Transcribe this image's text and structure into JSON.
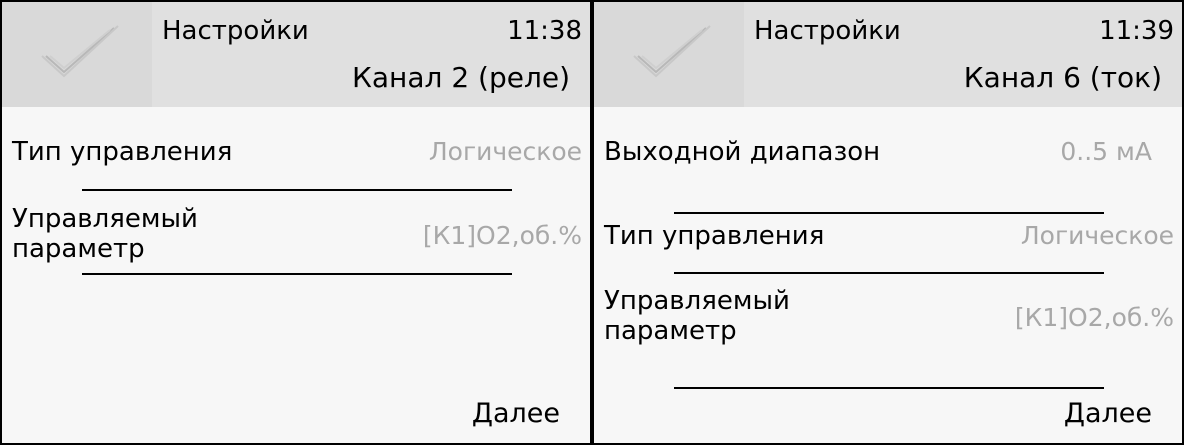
{
  "screens": [
    {
      "header": {
        "title": "Настройки",
        "time": "11:38",
        "channel": "Канал 2 (реле)"
      },
      "rows": [
        {
          "label": "Тип управления",
          "value": "Логическое"
        },
        {
          "label": "Управляемый параметр",
          "value": "[К1]О2,об.%"
        }
      ],
      "next_label": "Далее"
    },
    {
      "header": {
        "title": "Настройки",
        "time": "11:39",
        "channel": "Канал 6 (ток)"
      },
      "rows": [
        {
          "label": "Выходной диапазон",
          "value": "0..5 мА"
        },
        {
          "label": "Тип управления",
          "value": "Логическое"
        },
        {
          "label": "Управляемый параметр",
          "value": "[К1]О2,об.%"
        }
      ],
      "next_label": "Далее"
    }
  ],
  "icons": {
    "logo": "checkmark-logo-icon"
  }
}
